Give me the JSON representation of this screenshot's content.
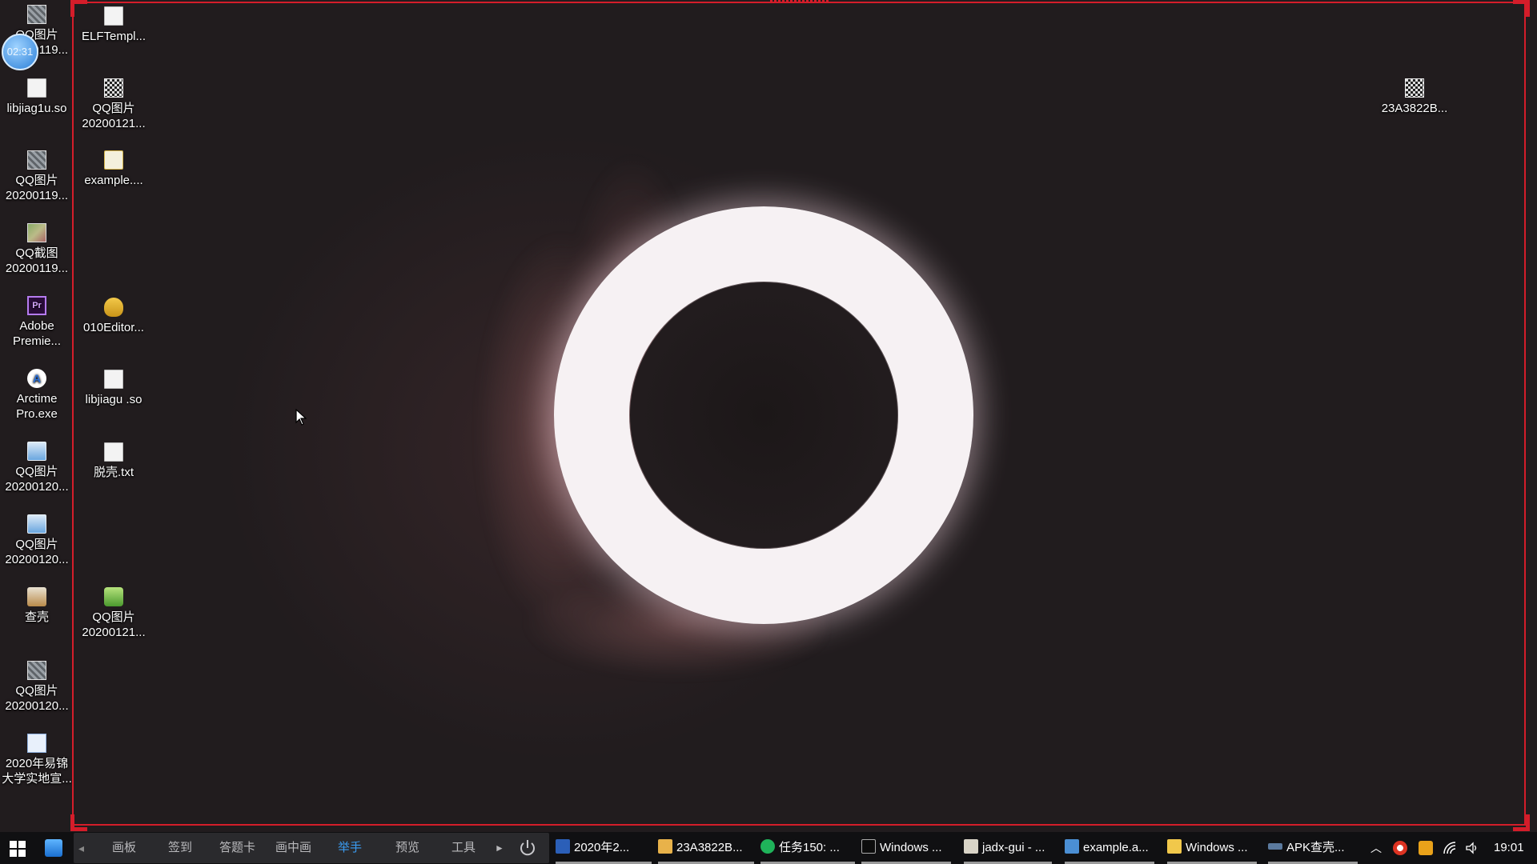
{
  "desktop_icons": [
    {
      "label": "QQ图片 20200119...",
      "icon": "image-icon"
    },
    {
      "label": "libjiag1u.so",
      "icon": "file-icon"
    },
    {
      "label": "QQ图片 20200119...",
      "icon": "image-icon"
    },
    {
      "label": "QQ截图 20200119...",
      "icon": "screenshot-icon"
    },
    {
      "label": "Adobe Premie...",
      "icon": "premiere-icon",
      "glyph": "Pr"
    },
    {
      "label": "Arctime Pro.exe",
      "icon": "arctime-icon",
      "glyph": "A"
    },
    {
      "label": "QQ图片 20200120...",
      "icon": "image-icon"
    },
    {
      "label": "QQ图片 20200120...",
      "icon": "image-icon"
    },
    {
      "label": "查壳",
      "icon": "java-icon"
    },
    {
      "label": "QQ图片 20200120...",
      "icon": "image-icon"
    },
    {
      "label": "2020年易锦大学实地宣...",
      "icon": "document-icon"
    },
    {
      "label": "ELFTempl...",
      "icon": "file-icon"
    },
    {
      "label": "QQ图片 20200121...",
      "icon": "qr-image-icon"
    },
    {
      "label": "example....",
      "icon": "apk-file-icon"
    },
    {
      "label": "010Editor...",
      "icon": "editor-icon"
    },
    {
      "label": "libjiagu .so",
      "icon": "file-icon"
    },
    {
      "label": "脱壳.txt",
      "icon": "text-file-icon"
    },
    {
      "label": "QQ图片 20200121...",
      "icon": "apk-icon"
    },
    {
      "label": "23A3822B...",
      "icon": "qr-image-icon"
    }
  ],
  "recording_timer": "02:31",
  "recording_toolbar": {
    "items": [
      "画板",
      "签到",
      "答题卡",
      "画中画",
      "举手",
      "预览",
      "工具"
    ],
    "active": "举手",
    "active_color": "#3a9cf2"
  },
  "taskbar": {
    "apps": [
      {
        "label": "2020年2...",
        "icon": "word-icon"
      },
      {
        "label": "23A3822B...",
        "icon": "image-viewer-icon"
      },
      {
        "label": "任务150: ...",
        "icon": "task-icon"
      },
      {
        "label": "Windows ...",
        "icon": "terminal-icon"
      },
      {
        "label": "jadx-gui - ...",
        "icon": "java-icon"
      },
      {
        "label": "example.a...",
        "icon": "archive-icon"
      },
      {
        "label": "Windows ...",
        "icon": "folder-icon"
      },
      {
        "label": "APK查壳...",
        "icon": "apk-checker-icon"
      }
    ],
    "clock": "19:01"
  },
  "colors": {
    "recording_frame": "#d41d2a",
    "taskbar_bg": "#101012"
  }
}
